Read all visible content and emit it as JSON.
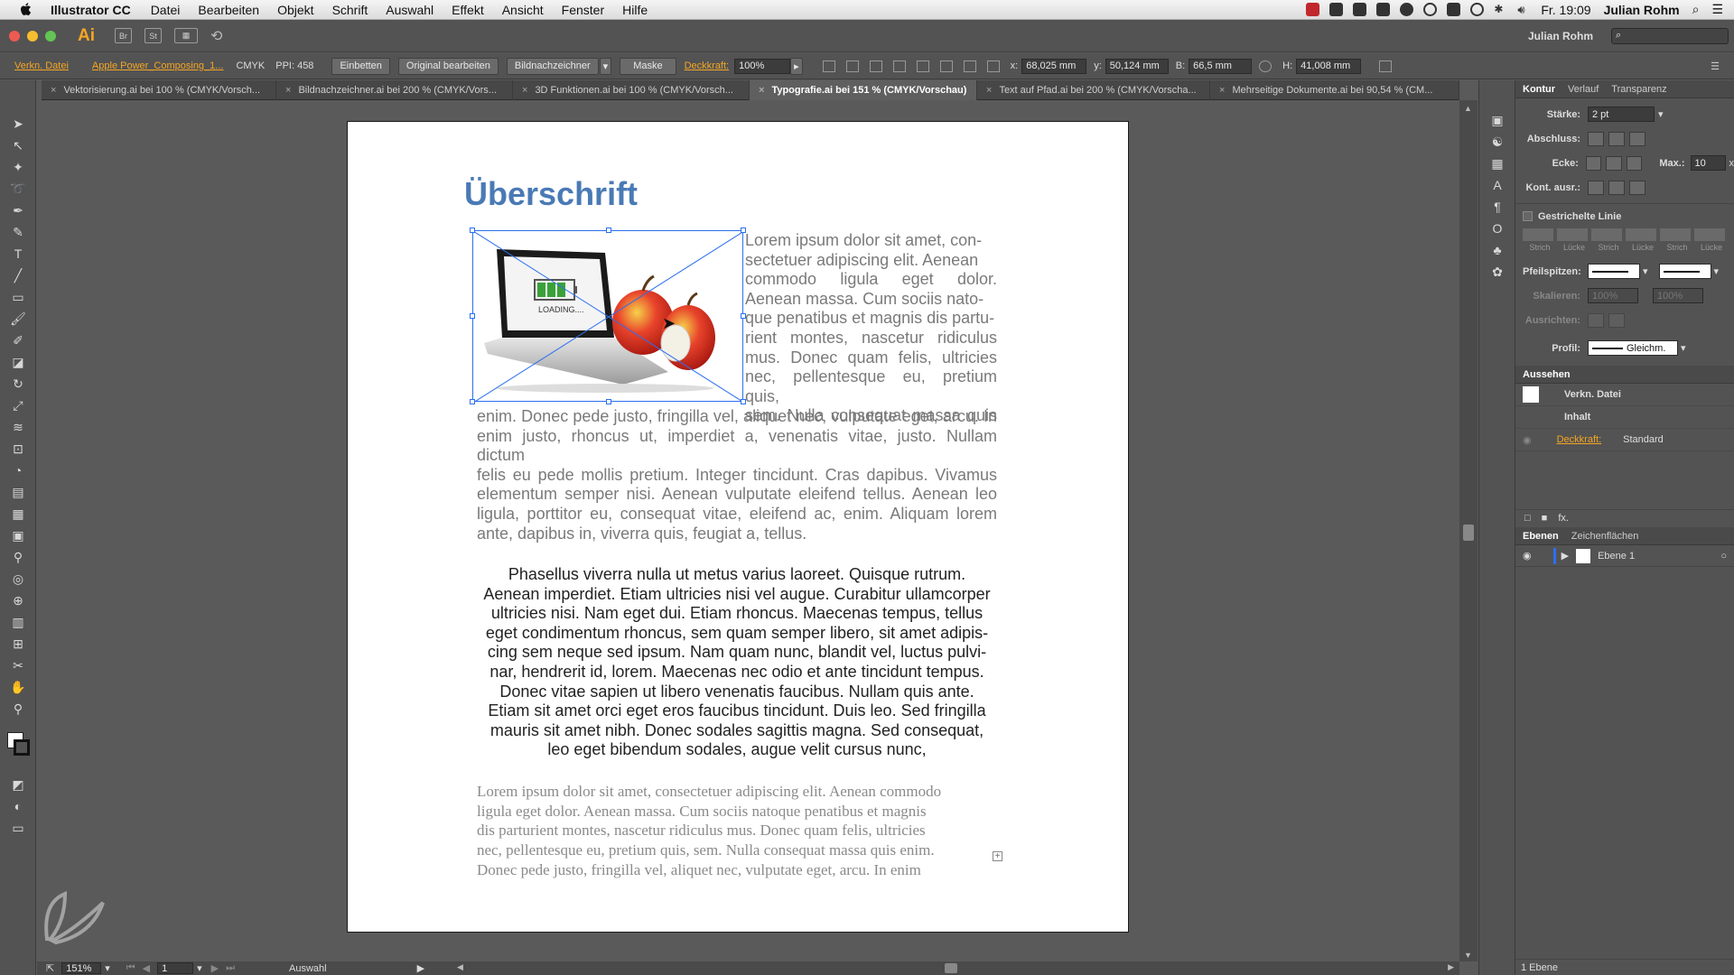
{
  "menubar": {
    "app": "Illustrator CC",
    "items": [
      "Datei",
      "Bearbeiten",
      "Objekt",
      "Schrift",
      "Auswahl",
      "Effekt",
      "Ansicht",
      "Fenster",
      "Hilfe"
    ],
    "clock": "Fr. 19:09",
    "user": "Julian Rohm"
  },
  "appbar": {
    "logo": "Ai",
    "br": "Br",
    "st": "St",
    "user": "Julian Rohm"
  },
  "control": {
    "linked": "Verkn. Datei",
    "filename": "Apple Power_Composing_1...",
    "mode": "CMYK",
    "ppi": "PPI: 458",
    "embed": "Einbetten",
    "edit_original": "Original bearbeiten",
    "trace": "Bildnachzeichner",
    "mask": "Maske",
    "opacity_label": "Deckkraft:",
    "opacity": "100%",
    "x_label": "x:",
    "x": "68,025 mm",
    "y_label": "y:",
    "y": "50,124 mm",
    "w_label": "B:",
    "w": "66,5 mm",
    "h_label": "H:",
    "h": "41,008 mm"
  },
  "tabs": [
    {
      "label": "Vektorisierung.ai bei 100 % (CMYK/Vorsch..."
    },
    {
      "label": "Bildnachzeichner.ai bei 200 % (CMYK/Vors..."
    },
    {
      "label": "3D Funktionen.ai bei 100 % (CMYK/Vorsch..."
    },
    {
      "label": "Typografie.ai bei 151 % (CMYK/Vorschau)"
    },
    {
      "label": "Text auf Pfad.ai bei 200 % (CMYK/Vorscha..."
    },
    {
      "label": "Mehrseitige Dokumente.ai bei 90,54 % (CM..."
    }
  ],
  "document": {
    "heading": "Überschrift",
    "image_text": "LOADING....",
    "para1_beside": [
      "Lorem ipsum dolor sit amet, con-",
      "sectetuer adipiscing elit. Aenean",
      "commodo ligula eget dolor.",
      "Aenean massa. Cum sociis nato-",
      "que penatibus et magnis dis partu-",
      "rient montes, nascetur ridiculus",
      "mus. Donec quam felis, ultricies",
      "nec, pellentesque eu, pretium quis,",
      "sem. Nulla consequat massa quis"
    ],
    "para1_full": [
      "enim. Donec pede justo, fringilla vel, aliquet nec, vulputate eget, arcu. In",
      "enim justo, rhoncus ut, imperdiet a, venenatis vitae, justo. Nullam dictum",
      "felis eu pede mollis pretium. Integer tincidunt. Cras dapibus. Vivamus",
      "elementum semper nisi. Aenean vulputate eleifend tellus. Aenean leo",
      "ligula, porttitor eu, consequat vitae, eleifend ac, enim. Aliquam lorem",
      "ante, dapibus in, viverra quis, feugiat a, tellus."
    ],
    "para2": [
      "Phasellus viverra nulla ut metus varius laoreet. Quisque rutrum.",
      "Aenean imperdiet. Etiam ultricies nisi vel augue. Curabitur ullamcorper",
      "ultricies nisi. Nam eget dui. Etiam rhoncus. Maecenas tempus, tellus",
      "eget condimentum rhoncus, sem quam semper libero, sit amet adipis-",
      "cing sem neque sed ipsum. Nam quam nunc, blandit vel, luctus pulvi-",
      "nar, hendrerit id, lorem. Maecenas nec odio et ante tincidunt tempus.",
      "Donec vitae sapien ut libero venenatis faucibus. Nullam quis ante.",
      "Etiam sit amet orci eget eros faucibus tincidunt. Duis leo. Sed fringilla",
      "mauris sit amet nibh. Donec sodales sagittis magna. Sed consequat,",
      "leo eget bibendum sodales, augue velit cursus nunc,"
    ],
    "para3": [
      "Lorem ipsum dolor sit amet, consectetuer adipiscing elit. Aenean commodo",
      "ligula eget dolor. Aenean massa. Cum sociis natoque penatibus et magnis",
      "dis parturient montes, nascetur ridiculus mus. Donec quam felis, ultricies",
      "nec, pellentesque eu, pretium quis, sem. Nulla consequat massa quis enim.",
      "Donec pede justo, fringilla vel, aliquet nec, vulputate eget, arcu. In enim"
    ]
  },
  "status": {
    "zoom": "151%",
    "page": "1",
    "tool": "Auswahl"
  },
  "panel": {
    "tabs": [
      "Kontur",
      "Verlauf",
      "Transparenz"
    ],
    "staerke_label": "Stärke:",
    "staerke": "2 pt",
    "abschluss_label": "Abschluss:",
    "ecke_label": "Ecke:",
    "max_label": "Max.:",
    "max": "10",
    "max_unit": "x",
    "kont_label": "Kont. ausr.:",
    "dashed": "Gestrichelte Linie",
    "dash_labels": [
      "Strich",
      "Lücke",
      "Strich",
      "Lücke",
      "Strich",
      "Lücke"
    ],
    "pfeil_label": "Pfeilspitzen:",
    "skalieren_label": "Skalieren:",
    "skalieren_a": "100%",
    "skalieren_b": "100%",
    "ausrichten_label": "Ausrichten:",
    "profil_label": "Profil:",
    "profil": "Gleichm.",
    "aussehen": {
      "title": "Aussehen",
      "item": "Verkn. Datei",
      "inhalt": "Inhalt",
      "deckkraft": "Deckkraft:",
      "deckkraft_val": "Standard",
      "fx": "fx."
    },
    "ebenen": {
      "tabs": [
        "Ebenen",
        "Zeichenflächen"
      ],
      "layer": "Ebene 1",
      "count": "1 Ebene"
    }
  },
  "colors": {
    "accent": "#f5a623",
    "heading": "#4a7ab5",
    "selection": "#2b6ff0"
  }
}
